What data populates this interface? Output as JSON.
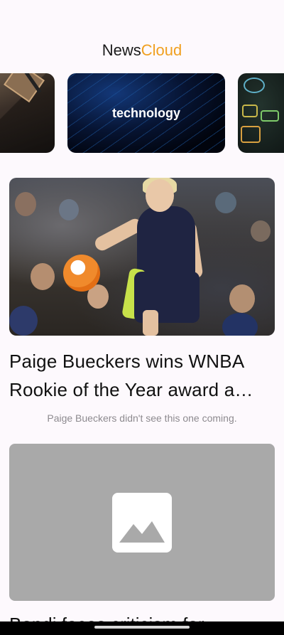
{
  "header": {
    "title_part1": "News",
    "title_part2": "Cloud",
    "accent_color": "#f0a020"
  },
  "categories": [
    {
      "label": ""
    },
    {
      "label": "technology"
    },
    {
      "label": ""
    }
  ],
  "feed": {
    "articles": [
      {
        "headline_line1": "Paige Bueckers wins WNBA",
        "headline_line2": "Rookie of the Year award a…",
        "summary": "Paige Bueckers didn't see this one coming.",
        "image_icon": "photo"
      },
      {
        "headline_line1": "Bondi faces criticism for",
        "image_icon": "image-placeholder-icon"
      }
    ]
  }
}
